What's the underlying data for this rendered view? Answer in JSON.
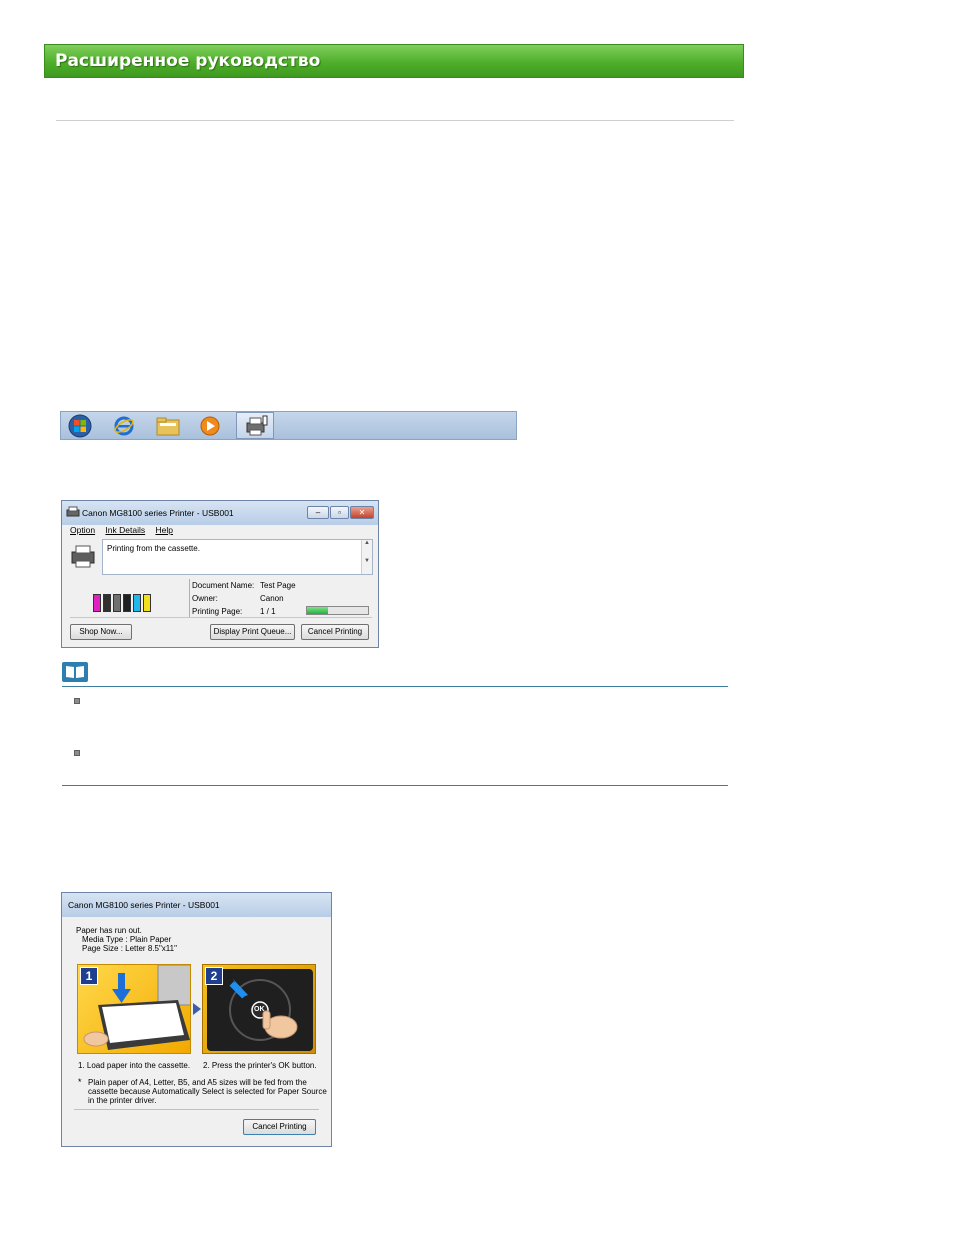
{
  "header": {
    "title": "Расширенное руководство"
  },
  "taskbar": {
    "icons": [
      "windows-start-icon",
      "internet-explorer-icon",
      "explorer-folder-icon",
      "media-player-icon",
      "printer-status-icon"
    ]
  },
  "window1": {
    "title": "Canon MG8100 series Printer - USB001",
    "menu": {
      "option": "Option",
      "ink_details": "Ink Details",
      "help": "Help"
    },
    "message": "Printing from the cassette.",
    "doc_name_label": "Document Name:",
    "doc_name_value": "Test Page",
    "owner_label": "Owner:",
    "owner_value": "Canon",
    "printing_page_label": "Printing Page:",
    "printing_page_value": "1 / 1",
    "progress_fraction": 0.35,
    "ink_colors": [
      "#e020c0",
      "#303030",
      "#707070",
      "#202020",
      "#20b8e8",
      "#f0e020"
    ],
    "buttons": {
      "shop_now": "Shop Now...",
      "display_queue": "Display Print Queue...",
      "cancel_printing": "Cancel Printing"
    }
  },
  "window2": {
    "title": "Canon MG8100 series Printer - USB001",
    "line1": "Paper has run out.",
    "line2": "Media Type : Plain Paper",
    "line3": "Page Size : Letter 8.5\"x11\"",
    "step1_num": "1",
    "step2_num": "2",
    "ok_label": "OK",
    "step1_text": "1.  Load paper into the cassette.",
    "step2_text": "2.  Press the printer's OK button.",
    "note_line1": "Plain paper of A4, Letter, B5, and A5 sizes will be fed from the",
    "note_line2": "cassette because Automatically Select is selected for Paper Source",
    "note_line3": "in the printer driver.",
    "cancel_button": "Cancel Printing"
  }
}
